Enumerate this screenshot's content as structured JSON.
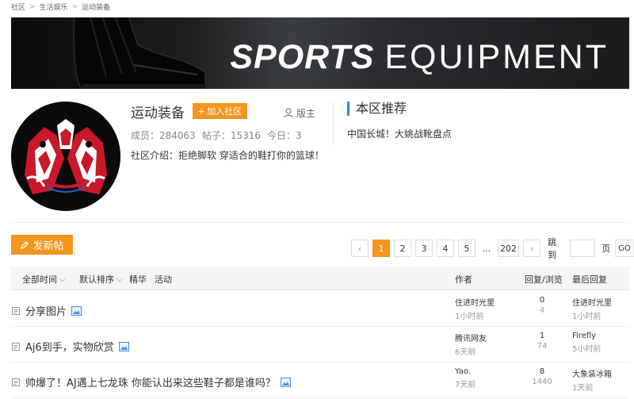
{
  "breadcrumb": [
    "社区",
    "生活娱乐",
    "运动装备"
  ],
  "banner": {
    "title_bold": "SPORTS",
    "title_light": "EQUIPMENT"
  },
  "community": {
    "name": "运动装备",
    "join_label": "加入社区",
    "moderator_label": "版主",
    "members": "成员：284063",
    "posts": "帖子：15316",
    "today": "今日：3",
    "intro": "社区介绍：拒绝脚软 穿适合的鞋打你的篮球！"
  },
  "recommend": {
    "title": "本区推荐",
    "item": "中国长城！大姚战靴盘点"
  },
  "toolbar": {
    "post_label": "发新帖"
  },
  "pager": {
    "prev": "‹",
    "pages": [
      "1",
      "2",
      "3",
      "4",
      "5"
    ],
    "dots": "...",
    "last": "202",
    "next": "›",
    "jump_label": "跳到",
    "page_label": "页",
    "go_label": "GO",
    "active": "1"
  },
  "table": {
    "filter_time": "全部时间",
    "filter_sort": "默认排序",
    "filter_best": "精华",
    "filter_activity": "活动",
    "col_author": "作者",
    "col_replies": "回复/浏览",
    "col_last": "最后回复",
    "rows": [
      {
        "title": "分享图片",
        "author": "住进时光里",
        "author_time": "1小时前",
        "replies": "0",
        "views": "4",
        "last_user": "住进时光里",
        "last_time": "1小时前"
      },
      {
        "title": "Aj6到手，实物欣赏",
        "author": "腾讯网友",
        "author_time": "6天前",
        "replies": "1",
        "views": "74",
        "last_user": "Firefly",
        "last_time": "5小时前"
      },
      {
        "title": "帅爆了！AJ遇上七龙珠 你能认出来这些鞋子都是谁吗？",
        "author": "Yao.",
        "author_time": "7天前",
        "replies": "8",
        "views": "1440",
        "last_user": "大象装冰箱",
        "last_time": "1天前"
      }
    ]
  },
  "colors": {
    "accent": "#f5941f",
    "blue_bar": "#3a88d3"
  }
}
